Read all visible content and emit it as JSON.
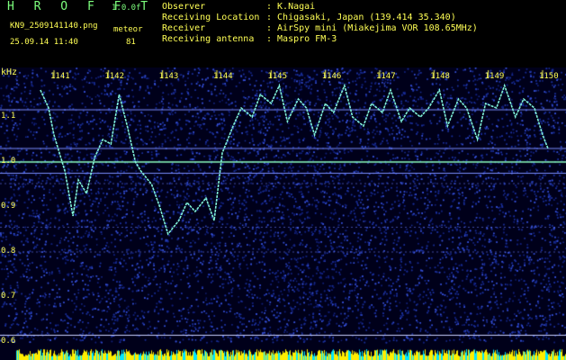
{
  "header": {
    "software_name": "H R O F F T",
    "software_version": "1.0.0f",
    "filename": "KN9_2509141140.png",
    "station_tag": "meteor",
    "date_time": "25.09.14 11:40",
    "count": "81",
    "meta": [
      {
        "key": "Observer",
        "value": ": K.Nagai"
      },
      {
        "key": "Receiving Location",
        "value": ": Chigasaki, Japan (139.414 35.340)"
      },
      {
        "key": "Receiver",
        "value": ": AirSpy mini (Miakejima VOR 108.65MHz)"
      },
      {
        "key": "Receiving antenna",
        "value": ": Maspro FM-3"
      }
    ]
  },
  "colors": {
    "background": "#000000",
    "text": "#ffff55",
    "title": "#7dff7d",
    "signal": "#7ff0d8",
    "noise": "#1a2f9a",
    "level_bar": "#ffee00"
  },
  "chart_data": {
    "type": "heatmap",
    "title": "",
    "y_unit": "kHz",
    "ylim": [
      0.6,
      1.2
    ],
    "y_ticks": [
      "1.1",
      "1.0",
      "0.9",
      "0.8",
      "0.7",
      "0.6"
    ],
    "x_ticks": [
      "1141",
      "1142",
      "1143",
      "1144",
      "1145",
      "1146",
      "1147",
      "1148",
      "1149",
      "1150"
    ],
    "carrier_freq_khz": 1.0,
    "series": [
      {
        "t": [
          1140.75,
          1140.9,
          1141.0,
          1141.2,
          1141.35,
          1141.45,
          1141.6,
          1141.75,
          1141.9,
          1142.05,
          1142.2,
          1142.35,
          1142.5,
          1142.6,
          1142.8,
          1142.95,
          1143.1,
          1143.3,
          1143.45,
          1143.6,
          1143.8,
          1143.95,
          1144.1,
          1144.3,
          1144.45,
          1144.65,
          1144.8,
          1145.0,
          1145.15,
          1145.3,
          1145.5,
          1145.65,
          1145.8,
          1146.0,
          1146.15,
          1146.35,
          1146.5,
          1146.7,
          1146.85,
          1147.05,
          1147.2,
          1147.4,
          1147.55,
          1147.75,
          1147.9,
          1148.1,
          1148.25,
          1148.45,
          1148.6,
          1148.8,
          1148.95,
          1149.15,
          1149.3,
          1149.5,
          1149.65,
          1149.85,
          1150.0,
          1150.1
        ],
        "f": [
          1.16,
          1.12,
          1.06,
          0.98,
          0.88,
          0.96,
          0.93,
          1.01,
          1.05,
          1.04,
          1.15,
          1.08,
          1.0,
          0.98,
          0.95,
          0.9,
          0.84,
          0.87,
          0.91,
          0.89,
          0.92,
          0.87,
          1.02,
          1.08,
          1.12,
          1.1,
          1.15,
          1.13,
          1.17,
          1.09,
          1.14,
          1.12,
          1.06,
          1.13,
          1.11,
          1.17,
          1.1,
          1.08,
          1.13,
          1.11,
          1.16,
          1.09,
          1.12,
          1.1,
          1.12,
          1.16,
          1.08,
          1.14,
          1.12,
          1.05,
          1.13,
          1.12,
          1.17,
          1.1,
          1.14,
          1.12,
          1.06,
          1.03
        ]
      }
    ]
  }
}
